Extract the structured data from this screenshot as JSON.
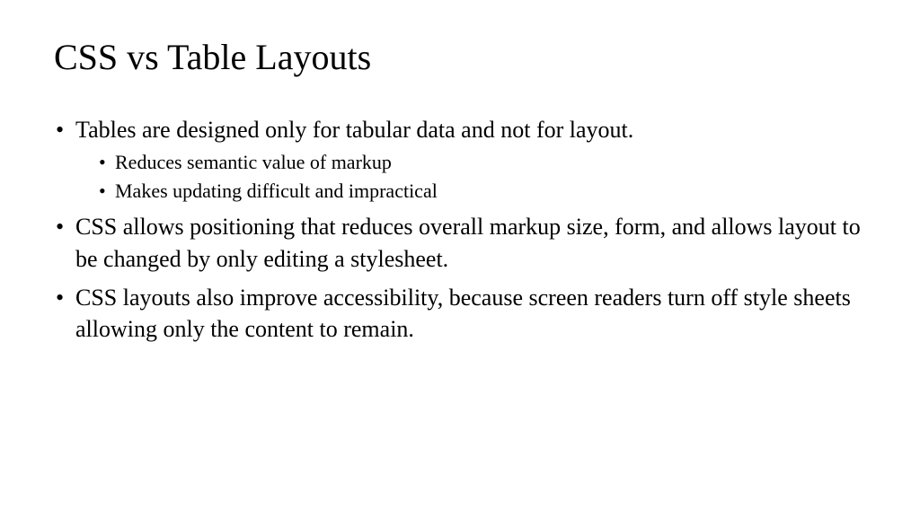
{
  "slide": {
    "title": "CSS vs Table Layouts",
    "bullets": [
      {
        "text": "Tables are designed only for tabular data and not for layout.",
        "subs": [
          "Reduces semantic value of markup",
          "Makes updating difficult and impractical"
        ]
      },
      {
        "text": "CSS allows positioning that reduces overall markup size, form, and allows layout to be changed by only editing a stylesheet."
      },
      {
        "text": "CSS layouts also improve accessibility, because screen readers turn off style sheets allowing only the content to remain."
      }
    ]
  }
}
